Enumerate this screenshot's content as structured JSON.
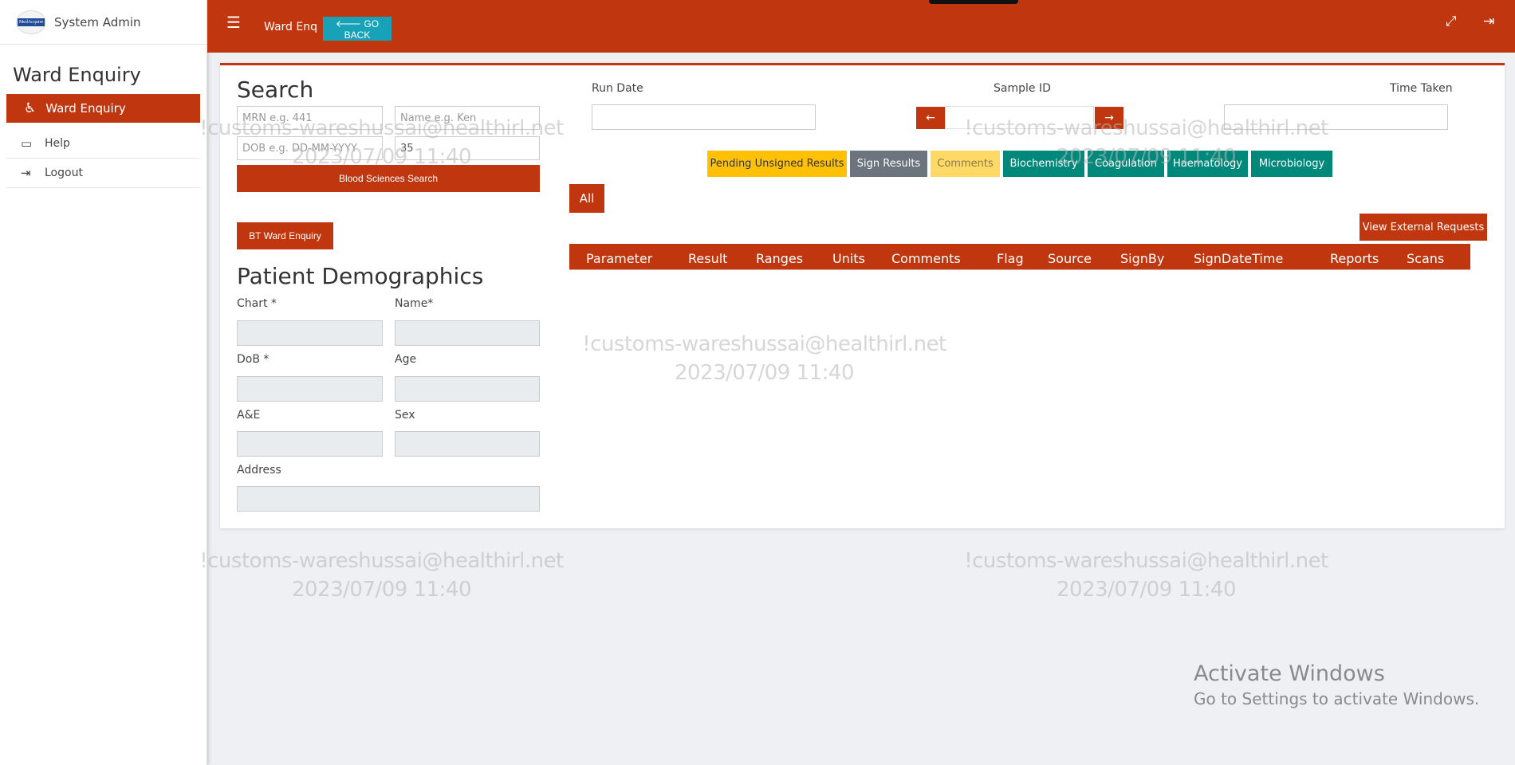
{
  "brand": {
    "logo_text": "MedAcquire",
    "user": "System Admin"
  },
  "sidebar": {
    "title": "Ward Enquiry",
    "active_item": {
      "label": "Ward Enquiry",
      "icon": "wheelchair-icon"
    },
    "items": [
      {
        "label": "Help",
        "icon": "ticket-icon"
      },
      {
        "label": "Logout",
        "icon": "sign-out-icon"
      }
    ]
  },
  "topbar": {
    "menu_icon": "☰",
    "title": "Ward Enq",
    "go_back": "🡐 GO BACK"
  },
  "search": {
    "heading": "Search",
    "mrn_placeholder": "MRN e.g. 441",
    "name_placeholder": "Name e.g. Ken",
    "dob_placeholder": "DOB e.g. DD-MM-YYYY",
    "age_value": "35",
    "search_button": "Blood Sciences Search",
    "bt_button": "BT Ward Enquiry"
  },
  "demographics": {
    "heading": "Patient Demographics",
    "chart_label": "Chart *",
    "name_label": "Name*",
    "dob_label": "DoB *",
    "age_label": "Age",
    "ae_label": "A&E",
    "sex_label": "Sex",
    "address_label": "Address"
  },
  "run": {
    "run_date_label": "Run Date",
    "sample_id_label": "Sample ID",
    "time_taken_label": "Time Taken"
  },
  "categories": [
    {
      "label": "Pending Unsigned Results",
      "bg": "#ffc107",
      "fg": "#333333"
    },
    {
      "label": "Sign Results",
      "bg": "#6c757d",
      "fg": "#ffffff"
    },
    {
      "label": "Comments",
      "bg": "#ffd966",
      "fg": "#8a7a4a"
    },
    {
      "label": "Biochemistry",
      "bg": "#00897b",
      "fg": "#ffffff"
    },
    {
      "label": "Coagulation",
      "bg": "#00897b",
      "fg": "#ffffff"
    },
    {
      "label": "Haematology",
      "bg": "#00897b",
      "fg": "#ffffff"
    },
    {
      "label": "Microbiology",
      "bg": "#00897b",
      "fg": "#ffffff"
    }
  ],
  "all_button": "All",
  "external_requests_button": "View External Requests",
  "table": {
    "columns": [
      "Parameter",
      "Result",
      "Ranges",
      "Units",
      "Comments",
      "Flag",
      "Source",
      "SignBy",
      "SignDateTime",
      "Reports",
      "Scans"
    ]
  },
  "watermark": {
    "line1": "!customs-wareshussai@healthirl.net",
    "line2": "2023/07/09 11:40"
  },
  "activate_windows": {
    "title": "Activate Windows",
    "subtitle": "Go to Settings to activate Windows."
  },
  "colors": {
    "primary": "#c0370f",
    "info": "#17a2b8",
    "teal": "#00897b"
  }
}
